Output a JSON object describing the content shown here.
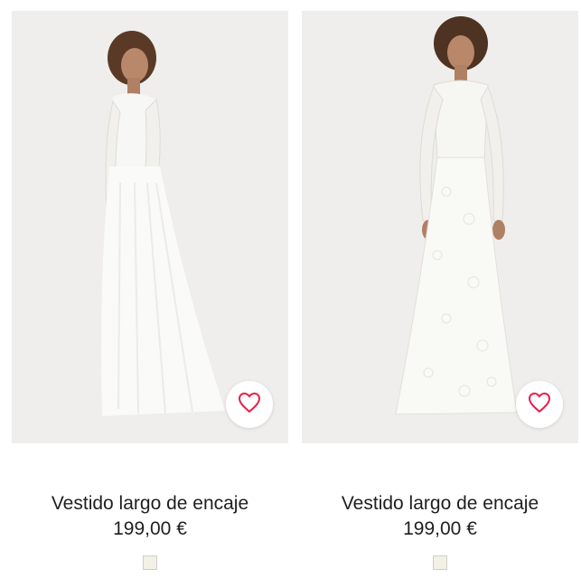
{
  "products": [
    {
      "name": "Vestido largo de encaje",
      "price": "199,00 €",
      "swatch_color": "#f3f1e6",
      "favorite_icon": "heart-outline-icon"
    },
    {
      "name": "Vestido largo de encaje",
      "price": "199,00 €",
      "swatch_color": "#f3f1e6",
      "favorite_icon": "heart-outline-icon"
    }
  ],
  "colors": {
    "photo_bg": "#efeeec",
    "heart": "#e4214b"
  }
}
